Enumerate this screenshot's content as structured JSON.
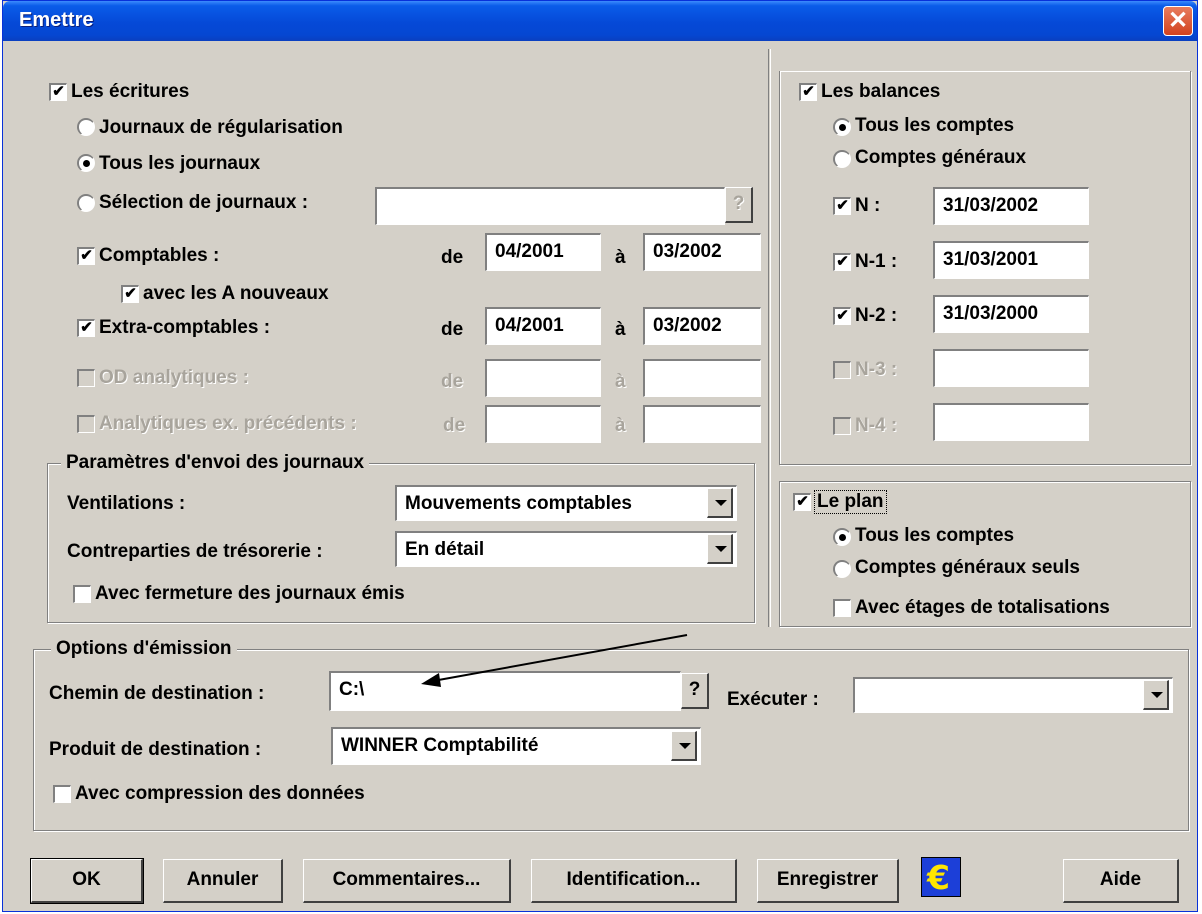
{
  "window": {
    "title": "Emettre",
    "close": "✕"
  },
  "ecritures": {
    "label": "Les écritures",
    "radio_journaux_regularisation": "Journaux de régularisation",
    "radio_tous_journaux": "Tous les journaux",
    "radio_selection": "Sélection de journaux :",
    "selection_value": "",
    "help": "?",
    "comptables": "Comptables :",
    "avec_a_nouveaux": "avec les A nouveaux",
    "extra_comptables": "Extra-comptables :",
    "od_analytiques": "OD analytiques :",
    "analytiques_prec": "Analytiques ex. précédents :",
    "de": "de",
    "a": "à",
    "comptables_de": "04/2001",
    "comptables_a": "03/2002",
    "extra_de": "04/2001",
    "extra_a": "03/2002"
  },
  "parametres": {
    "group_label": "Paramètres d'envoi des journaux",
    "ventilations_label": "Ventilations :",
    "ventilations_value": "Mouvements comptables",
    "contreparties_label": "Contreparties de trésorerie :",
    "contreparties_value": "En détail",
    "fermeture": "Avec fermeture des journaux émis"
  },
  "balances": {
    "label": "Les balances",
    "tous_comptes": "Tous les comptes",
    "comptes_generaux": "Comptes généraux",
    "n_label": "N :",
    "n1_label": "N-1 :",
    "n2_label": "N-2 :",
    "n3_label": "N-3 :",
    "n4_label": "N-4 :",
    "n_value": "31/03/2002",
    "n1_value": "31/03/2001",
    "n2_value": "31/03/2000"
  },
  "plan": {
    "label": "Le plan",
    "tous_comptes": "Tous les comptes",
    "comptes_generaux_seuls": "Comptes généraux seuls",
    "etages": "Avec étages de totalisations"
  },
  "options": {
    "group_label": "Options d'émission",
    "chemin_label": "Chemin de destination :",
    "chemin_value": "C:\\",
    "help": "?",
    "executer_label": "Exécuter :",
    "executer_value": "",
    "produit_label": "Produit de destination :",
    "produit_value": "WINNER Comptabilité",
    "compression": "Avec compression des données"
  },
  "buttons": {
    "ok": "OK",
    "annuler": "Annuler",
    "commentaires": "Commentaires...",
    "identification": "Identification...",
    "enregistrer": "Enregistrer",
    "euro": "€",
    "aide": "Aide"
  },
  "colors": {
    "dialog_bg": "#d4d0c8",
    "titlebar": "#0549d7",
    "euro_bg": "#1c3fd8",
    "euro_fg": "#ffe600"
  }
}
